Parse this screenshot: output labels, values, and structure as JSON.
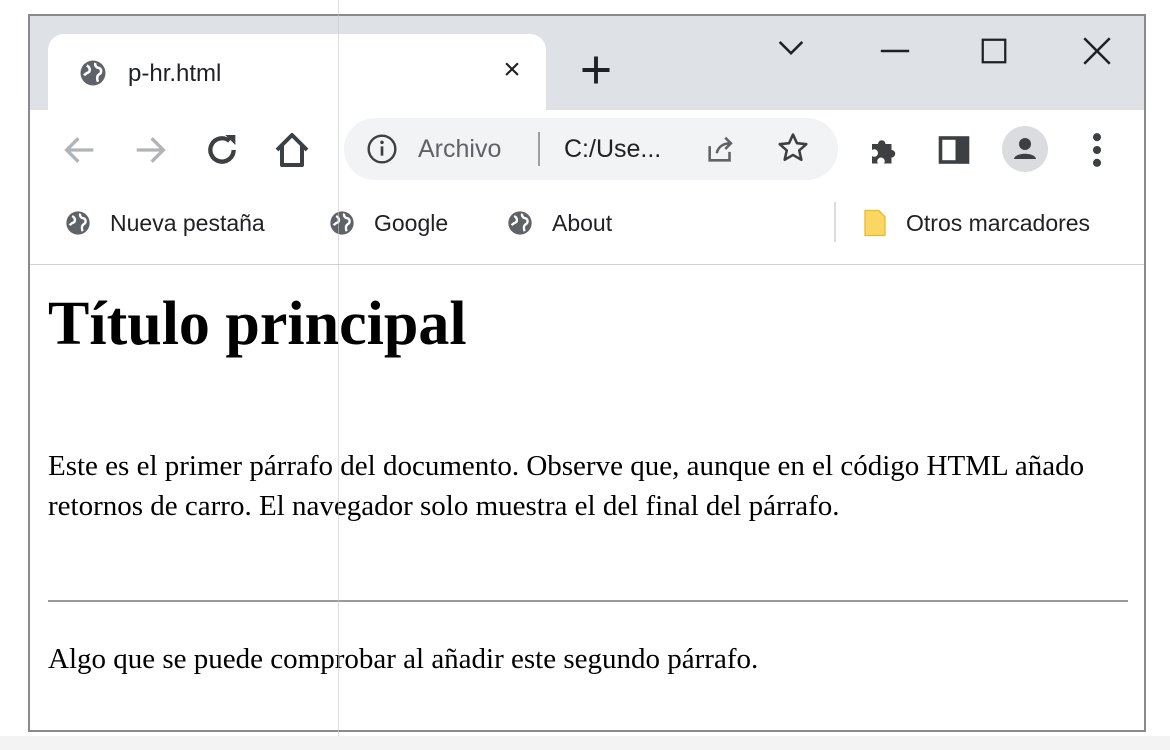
{
  "window": {
    "tab": {
      "title": "p-hr.html",
      "close_glyph": "×"
    },
    "new_tab_icon": "plus-icon",
    "controls": [
      "tab-search-icon",
      "minimize-icon",
      "maximize-icon",
      "close-icon"
    ]
  },
  "toolbar": {
    "nav_icons": [
      "back-arrow-icon",
      "forward-arrow-icon",
      "reload-icon",
      "home-icon"
    ],
    "omnibox": {
      "security_label": "Archivo",
      "url": "C:/Use..."
    },
    "extension_icons": [
      "share-icon",
      "star-icon",
      "puzzle-icon",
      "side-panel-icon",
      "profile-icon",
      "menu-icon"
    ]
  },
  "bookmarks": {
    "items": [
      {
        "label": "Nueva pestaña",
        "icon": "globe-icon"
      },
      {
        "label": "Google",
        "icon": "globe-icon"
      },
      {
        "label": "About",
        "icon": "globe-icon"
      }
    ],
    "other": {
      "label": "Otros marcadores",
      "icon": "folder-icon"
    }
  },
  "page": {
    "heading": "Título principal",
    "paragraph1": "Este es el primer párrafo del documento. Observe que, aunque en el código HTML añado retornos de carro. El navegador solo muestra el del final del párrafo.",
    "paragraph2": "Algo que se puede comprobar al añadir este segundo párrafo."
  },
  "colors": {
    "tabstrip": "#dee1e6",
    "omnibox": "#f1f3f4",
    "folder": "#fcd663"
  }
}
